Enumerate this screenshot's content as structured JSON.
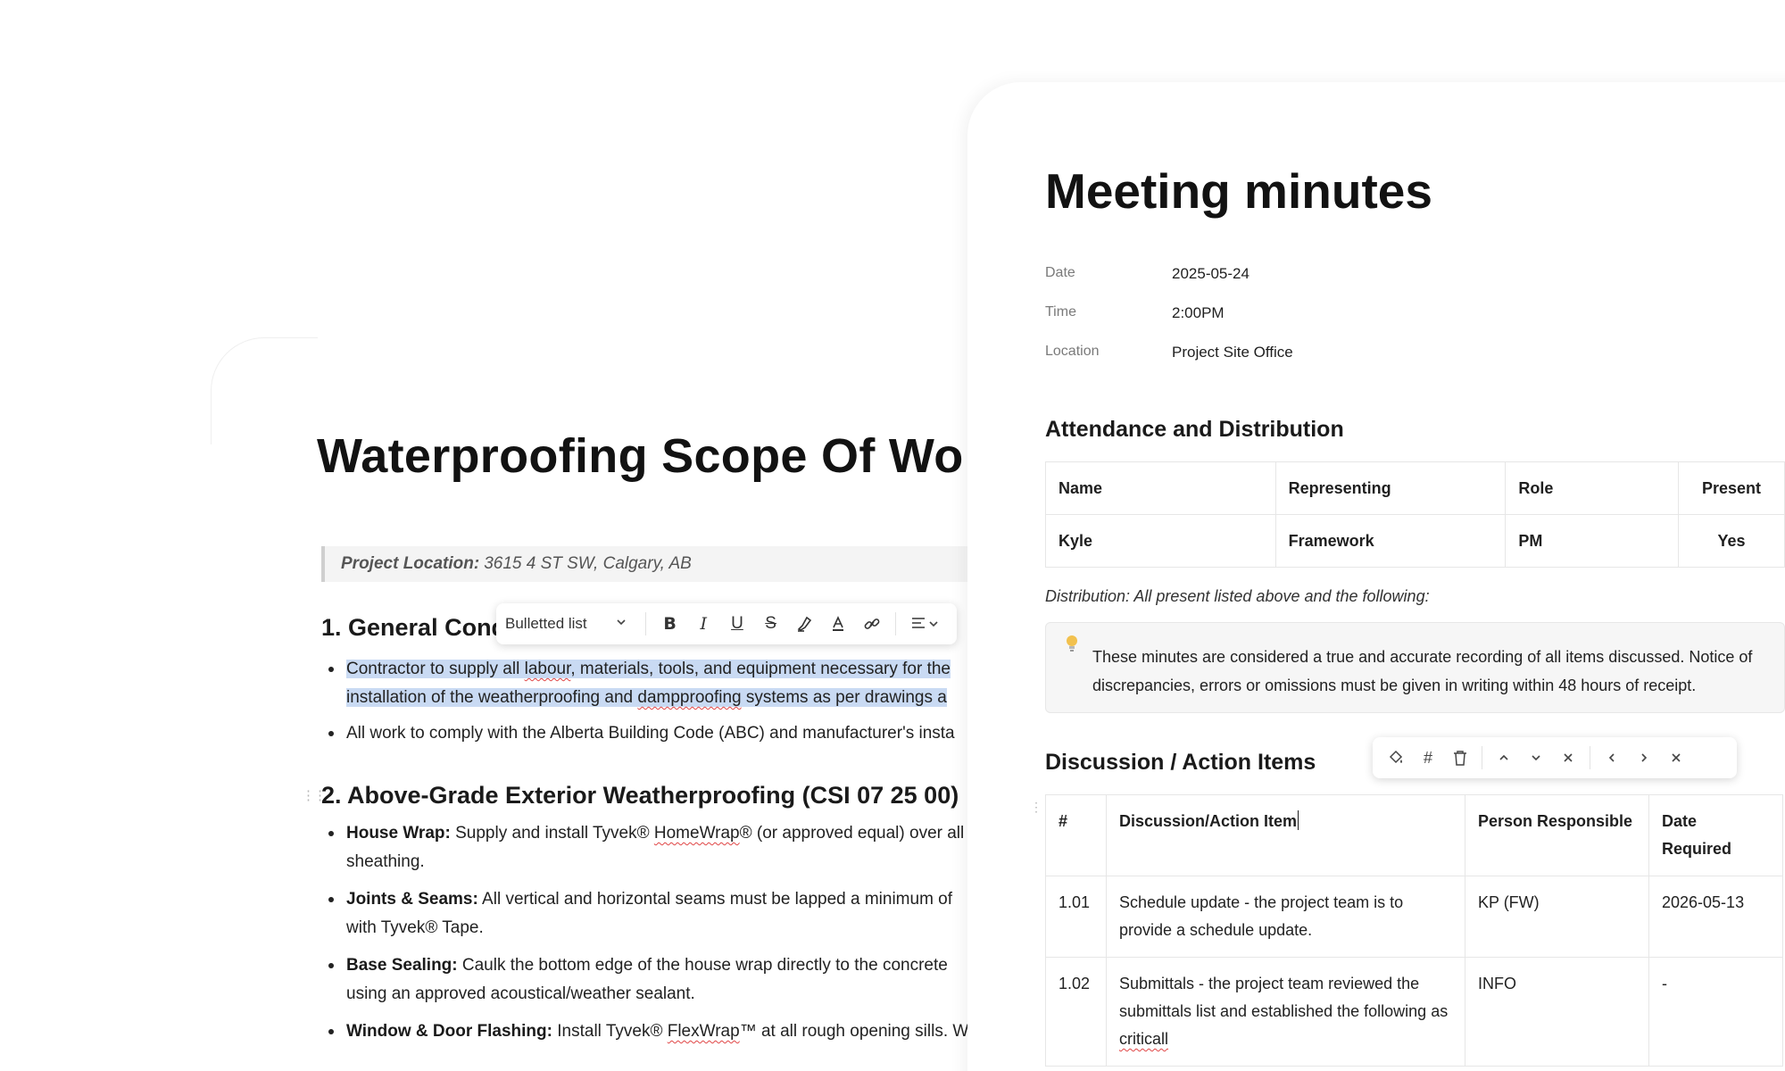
{
  "left_doc": {
    "title": "Waterproofing Scope Of Wo",
    "project_location_label": "Project Location:",
    "project_location_value": "3615 4 ST SW, Calgary, AB",
    "section1_heading": "1. General Condi",
    "section1_bullets": [
      {
        "line1_a": "Contractor to supply all ",
        "line1_sq": "labour",
        "line1_b": ", materials, tools, and equipment necessary for the",
        "line2_a": "installation of the weatherproofing and ",
        "line2_sq": "dampproofing",
        "line2_b": " systems as per drawings a"
      },
      {
        "text": "All work to comply with the Alberta Building Code (ABC) and manufacturer's insta"
      }
    ],
    "section2_heading": "2. Above-Grade Exterior Weatherproofing (CSI 07 25 00)",
    "section2_bullets": [
      {
        "label": "House Wrap:",
        "line1_a": " Supply and install Tyvek® ",
        "line1_sq": "HomeWrap",
        "line1_b": "® (or approved equal) over all",
        "line2": "sheathing."
      },
      {
        "label": "Joints & Seams:",
        "line1": " All vertical and horizontal seams must be lapped a minimum of",
        "line2": "with Tyvek® Tape."
      },
      {
        "label": "Base Sealing:",
        "line1": " Caulk the bottom edge of the house wrap directly to the concrete",
        "line2": "using an approved acoustical/weather sealant."
      },
      {
        "label": "Window & Door Flashing:",
        "line1_a": " Install Tyvek® ",
        "line1_sq": "FlexWrap",
        "line1_b": "™ at all rough opening sills. W"
      }
    ]
  },
  "format_toolbar": {
    "block_type": "Bulletted list",
    "icons": [
      "bold-icon",
      "italic-icon",
      "underline-icon",
      "strikethrough-icon",
      "highlight-icon",
      "text-color-icon",
      "link-icon",
      "align-icon"
    ]
  },
  "right_doc": {
    "title": "Meeting minutes",
    "meta": [
      {
        "label": "Date",
        "value": "2025-05-24"
      },
      {
        "label": "Time",
        "value": "2:00PM"
      },
      {
        "label": "Location",
        "value": "Project Site Office"
      }
    ],
    "attendance_heading": "Attendance and Distribution",
    "attendance_table": {
      "headers": [
        "Name",
        "Representing",
        "Role",
        "Present"
      ],
      "rows": [
        [
          "Kyle",
          "Framework",
          "PM",
          "Yes"
        ]
      ]
    },
    "distribution_note": "Distribution: All present listed above and the following:",
    "callout_text": "These minutes are considered a true and accurate recording of all items discussed. Notice of discrepancies, errors or omissions must be given in writing within 48 hours of receipt.",
    "discussion_heading": "Discussion / Action Items",
    "action_table": {
      "headers": [
        "#",
        "Discussion/Action Item",
        "Person Responsible",
        "Date Required"
      ],
      "rows": [
        {
          "num": "1.01",
          "item": "Schedule update - the project team is to provide a schedule update.",
          "person": "KP (FW)",
          "date": "2026-05-13"
        },
        {
          "num": "1.02",
          "item_a": "Submittals - the project team reviewed the submittals list and established the following as ",
          "item_sq": "criticall",
          "person": "INFO",
          "date": "-"
        }
      ]
    }
  },
  "table_toolbar": {
    "icons": [
      "paint-bucket-icon",
      "hash-icon",
      "trash-icon",
      "chevron-up-icon",
      "chevron-down-icon",
      "close-icon",
      "chevron-left-icon",
      "chevron-right-icon",
      "close-icon"
    ]
  },
  "colors": {
    "selection": "#c9daf3",
    "spellcheck": "#e04545",
    "callout_bg": "#f6f6f6",
    "bulb": "#e3a72f"
  }
}
